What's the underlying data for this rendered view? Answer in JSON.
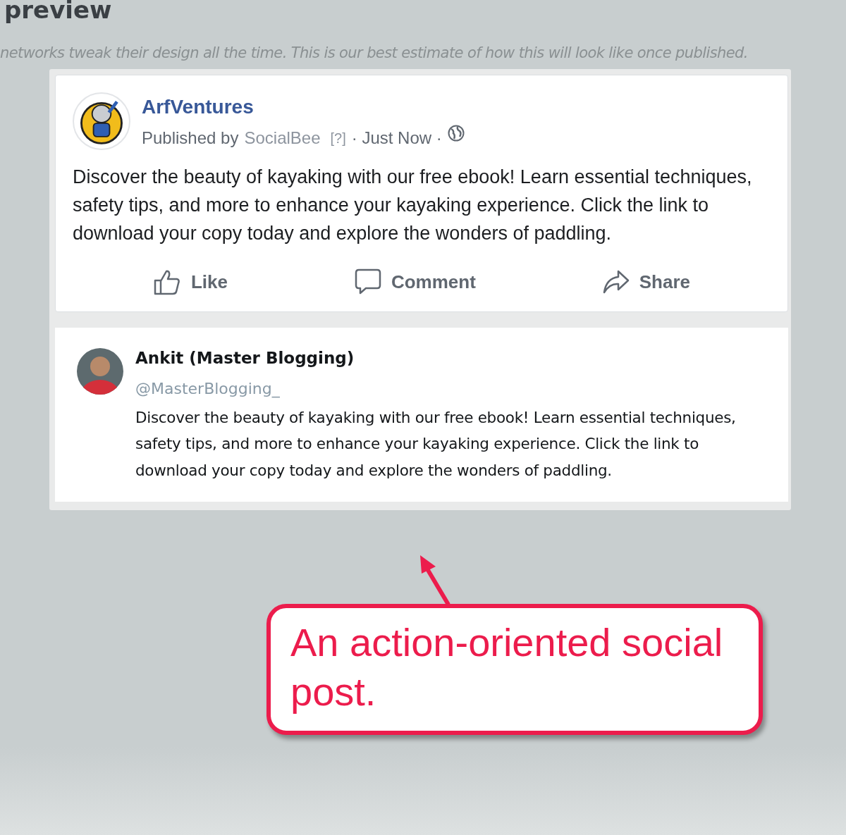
{
  "page": {
    "title": "preview",
    "disclaimer": "networks tweak their design all the time. This is our best estimate of how this will look like once published."
  },
  "facebook_post": {
    "page_name": "ArfVentures",
    "published_by": "Published by",
    "publisher": "SocialBee",
    "help_mark": "[?]",
    "time": "· Just Now ·",
    "text": "Discover the beauty of kayaking with our free ebook! Learn essential techniques, safety tips, and more to enhance your kayaking experience. Click the link to download your copy today and explore the wonders of paddling.",
    "actions": [
      {
        "label": "Like",
        "kind": "like"
      },
      {
        "label": "Comment",
        "kind": "comment"
      },
      {
        "label": "Share",
        "kind": "share"
      }
    ]
  },
  "twitter_post": {
    "name": "Ankit (Master Blogging)",
    "handle": "@MasterBlogging_",
    "text": "Discover the beauty of kayaking with our free ebook! Learn essential techniques, safety tips, and more to enhance your kayaking experience. Click the link to download your copy today and explore the wonders of paddling."
  },
  "annotation": {
    "text": "An action-oriented social post."
  }
}
